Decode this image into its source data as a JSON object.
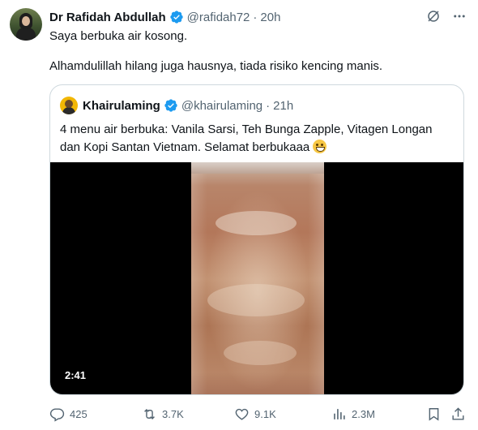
{
  "tweet": {
    "author_name": "Dr Rafidah Abdullah",
    "author_handle": "@rafidah72",
    "separator": "·",
    "time": "20h",
    "text_line1": "Saya berbuka air kosong.",
    "text_line2": "Alhamdulillah hilang juga hausnya, tiada risiko kencing manis."
  },
  "quote": {
    "author_name": "Khairulaming",
    "author_handle": "@khairulaming",
    "separator": "·",
    "time": "21h",
    "text": "4 menu air berbuka: Vanila Sarsi, Teh Bunga Zapple, Vitagen Longan dan Kopi Santan Vietnam. Selamat berbukaaa",
    "video_duration": "2:41"
  },
  "actions": {
    "replies": "425",
    "retweets": "3.7K",
    "likes": "9.1K",
    "views": "2.3M"
  },
  "colors": {
    "text": "#0f1419",
    "muted": "#536471",
    "verified": "#1d9bf0",
    "border": "#cfd9de"
  },
  "icons": {
    "verified": "verified-badge-icon",
    "grok": "grok-icon",
    "more": "more-icon",
    "reply": "reply-icon",
    "retweet": "retweet-icon",
    "like": "heart-icon",
    "views": "views-icon",
    "bookmark": "bookmark-icon",
    "share": "share-icon"
  }
}
